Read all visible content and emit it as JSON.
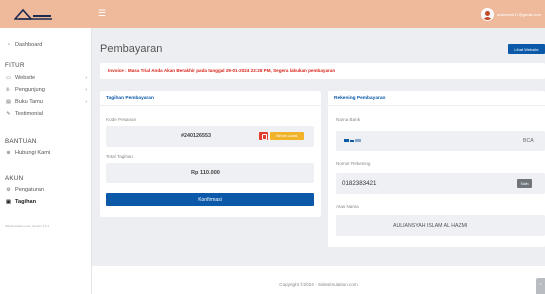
{
  "topbar": {
    "user_name": "aulianseh17@gmail.com",
    "menu_icon": "hamburger-icon"
  },
  "sidebar": {
    "items": [
      {
        "label": "Dashboard",
        "icon": "dashboard-icon"
      },
      {
        "label": "Website",
        "icon": "browser-icon"
      },
      {
        "label": "Pengunjung",
        "icon": "visitors-icon"
      },
      {
        "label": "Buku Tamu",
        "icon": "guestbook-icon"
      },
      {
        "label": "Testimonial",
        "icon": "testimonial-icon"
      },
      {
        "label": "Hubungi Kami",
        "icon": "help-icon"
      },
      {
        "label": "Pengaturan",
        "icon": "settings-icon"
      },
      {
        "label": "Tagihan",
        "icon": "bill-icon"
      }
    ],
    "sections": {
      "fitur": "FITUR",
      "bantuan": "BANTUAN",
      "akun": "AKUN"
    },
    "version": "Sidesimulation.com Version 4.0.1"
  },
  "main": {
    "title": "Pembayaran",
    "website_button": "Lihat Website",
    "invoice_notice": "Invoice : Masa Trial Anda Akan Berakhir pada tanggal 29-01-2024 23:28 PM, Segera lakukan pembayaran"
  },
  "billing": {
    "title": "Tagihan Pembayaran",
    "order_code_label": "Kode Pesanan",
    "order_code": "#240126553",
    "status": "Belum Lunas",
    "total_label": "Total Tagihan",
    "total": "Rp 110.000",
    "confirm_button": "Konfirmasi"
  },
  "account": {
    "title": "Rekening Pembayaran",
    "bank_label": "Nama Bank",
    "bank_name": "BCA",
    "number_label": "Nomor Rekening",
    "number": "0182383421",
    "copy_button": "Salin",
    "holder_label": "Atas Nama",
    "holder": "AULIANSYAH ISLAM AL HAZMI"
  },
  "footer": {
    "copyright": "Copyright ©2024 - Sidesimulation.com"
  },
  "colors": {
    "topbar": "#efb99b",
    "primary": "#0b59a8",
    "danger": "#d9261b",
    "warning": "#f0b32a"
  }
}
